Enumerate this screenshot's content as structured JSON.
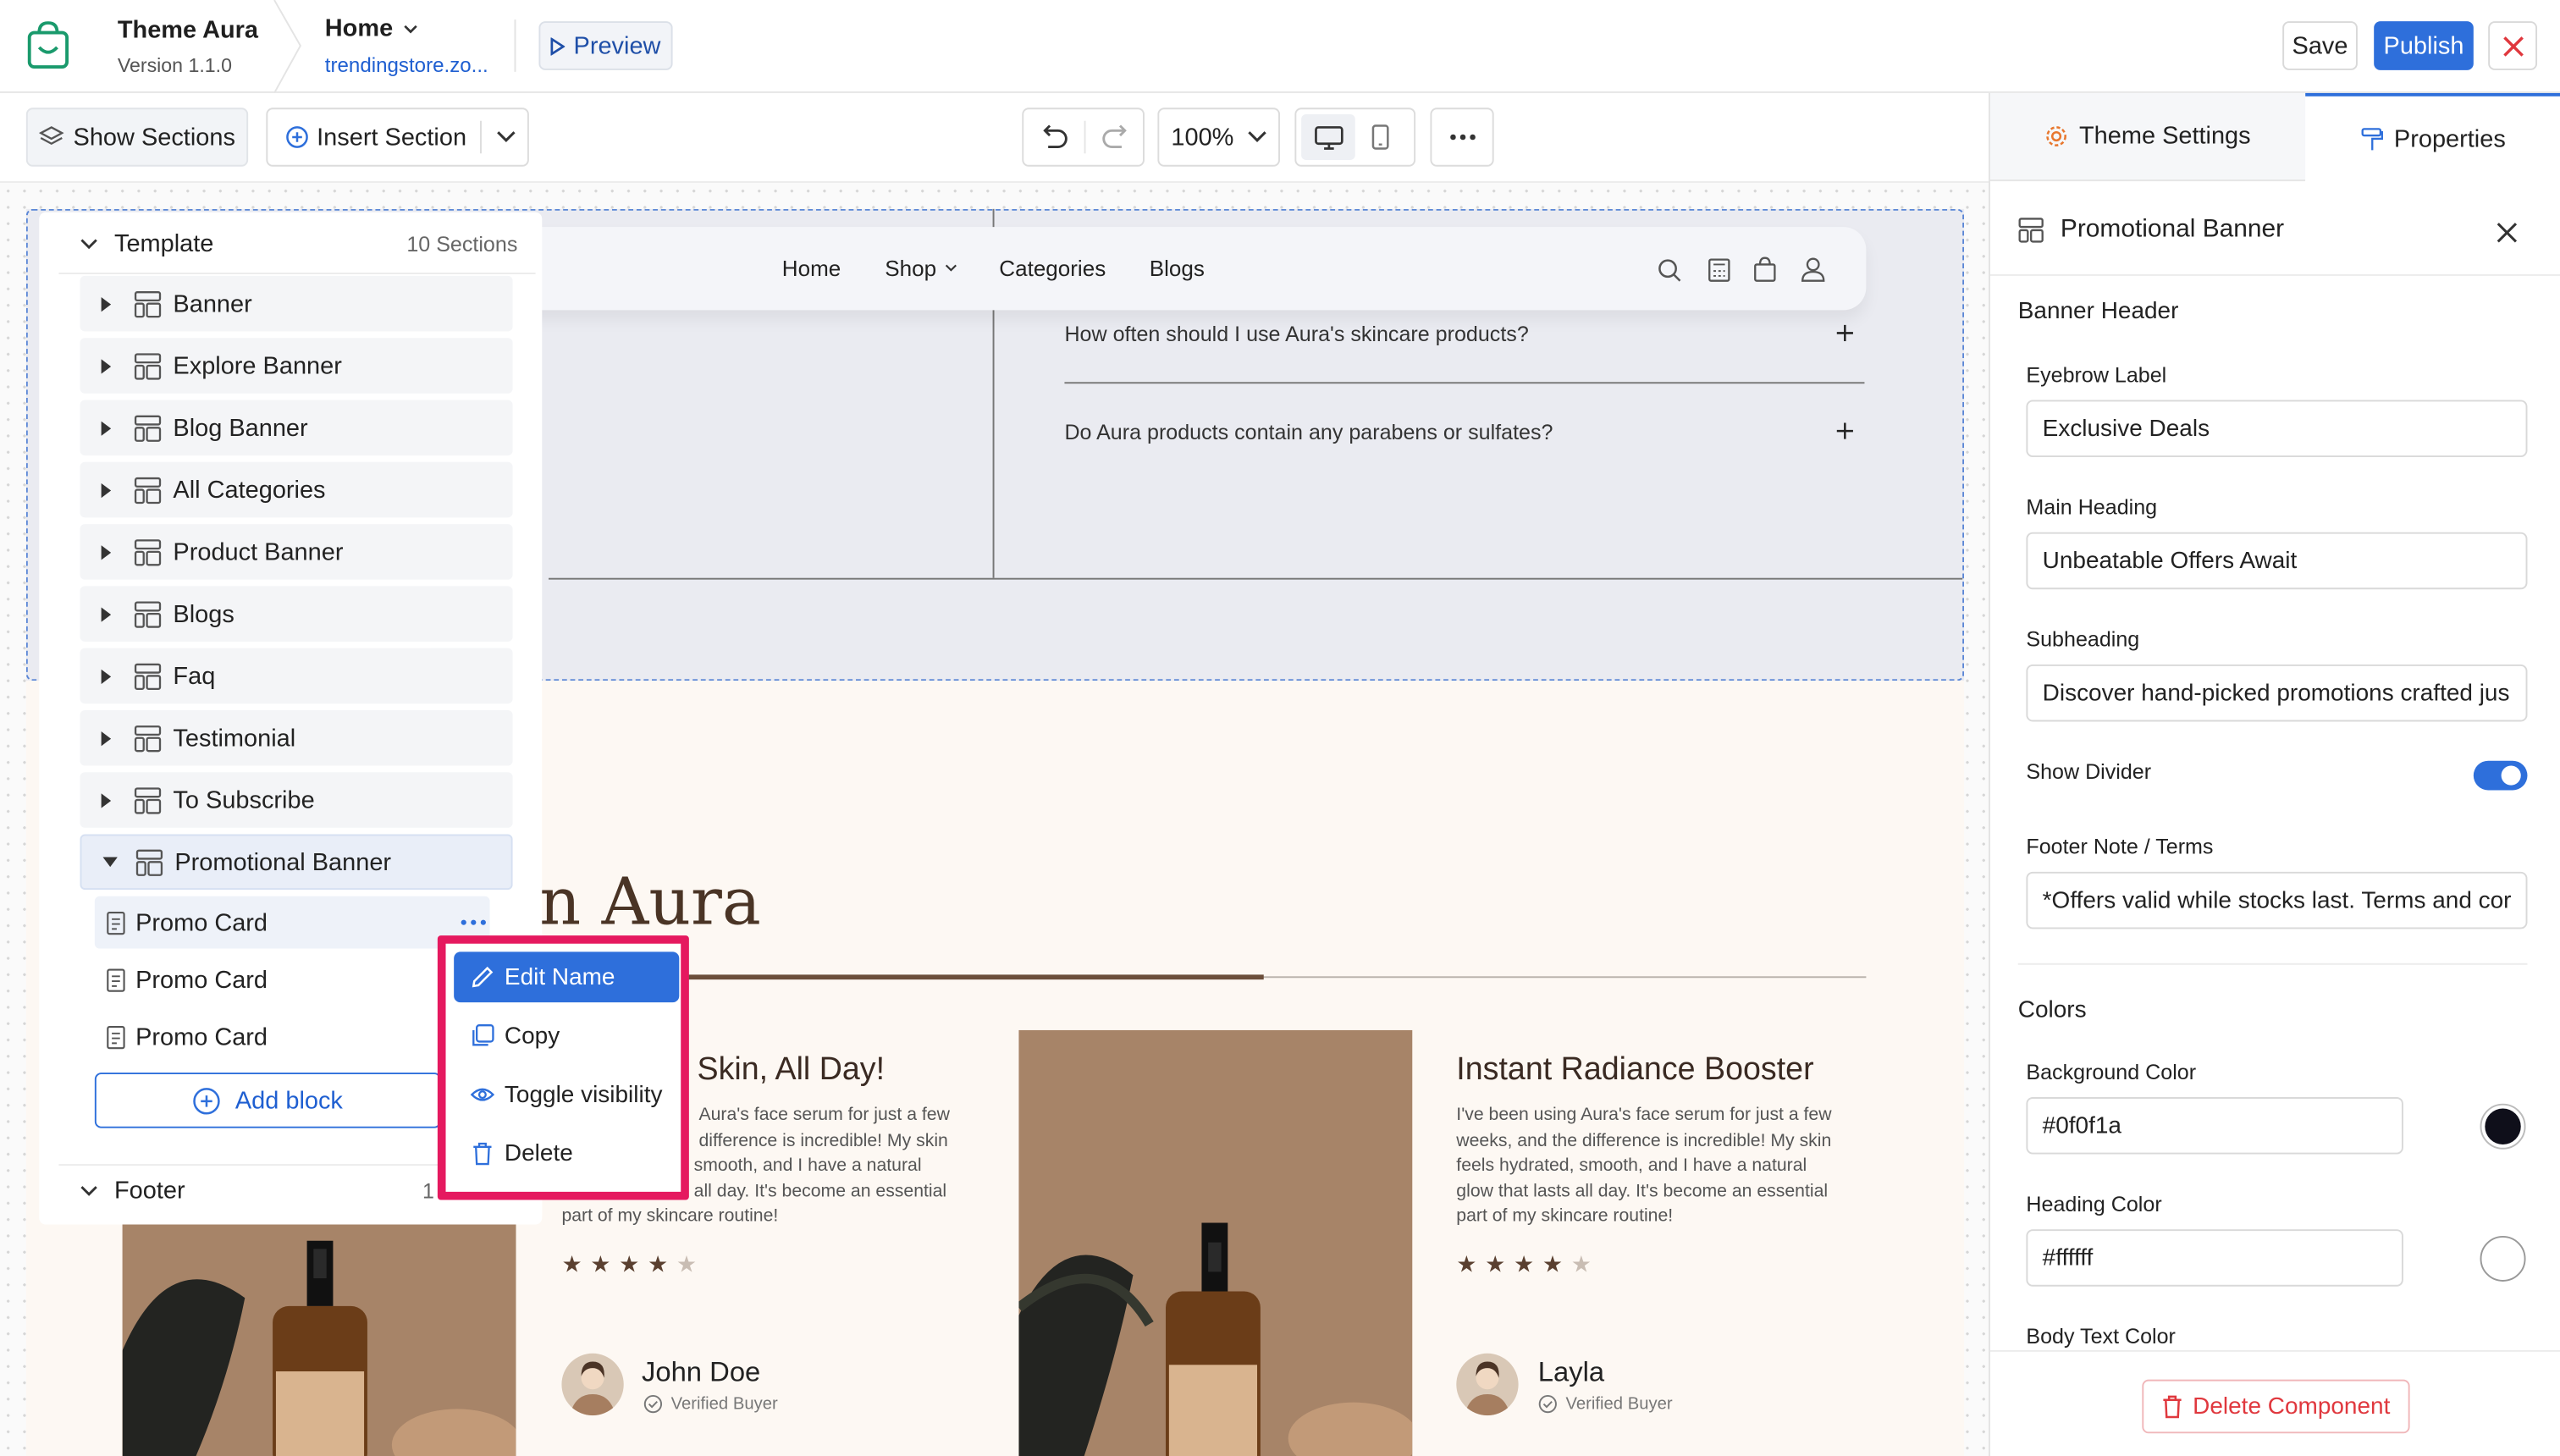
{
  "app": {
    "theme_name": "Theme Aura",
    "version": "Version 1.1.0",
    "page_name": "Home",
    "store_url": "trendingstore.zo...",
    "preview_label": "Preview",
    "save_label": "Save",
    "publish_label": "Publish",
    "accent_color": "#2e6fdb",
    "danger_color": "#e0383e"
  },
  "toolbar": {
    "show_sections_label": "Show Sections",
    "insert_section_label": "Insert Section",
    "zoom": "100%"
  },
  "sections_panel": {
    "template_label": "Template",
    "template_count": "10 Sections",
    "sections": [
      "Banner",
      "Explore Banner",
      "Blog Banner",
      "All Categories",
      "Product Banner",
      "Blogs",
      "Faq",
      "Testimonial",
      "To Subscribe",
      "Promotional Banner"
    ],
    "blocks": [
      "Promo Card",
      "Promo Card",
      "Promo Card"
    ],
    "add_block_label": "Add block",
    "footer_label": "Footer",
    "footer_count": "1"
  },
  "context_menu": {
    "items": [
      "Edit Name",
      "Copy",
      "Toggle visibility",
      "Delete"
    ]
  },
  "preview": {
    "nav": [
      "Home",
      "Shop",
      "Categories",
      "Blogs"
    ],
    "faq": [
      "How often should I use Aura's skincare products?",
      "Do Aura products contain any parabens or sulfates?"
    ],
    "testimonial_heading_partial": "n Aura",
    "cards": [
      {
        "title": "Skin, All Day!",
        "lines": [
          "Aura's face serum for just a few",
          "difference is incredible! My skin",
          "smooth, and I have a natural",
          "all day. It's become an essential",
          "part of my skincare routine!"
        ],
        "rating": 4,
        "name": "John Doe",
        "badge": "Verified Buyer"
      },
      {
        "title": "Instant Radiance Booster",
        "lines": [
          "I've been using Aura's face serum for just a few",
          "weeks, and the difference is incredible! My skin",
          "feels hydrated, smooth, and I have a natural",
          "glow that lasts all day. It's become an essential",
          "part of my skincare routine!"
        ],
        "rating": 4,
        "name": "Layla",
        "badge": "Verified Buyer"
      }
    ]
  },
  "properties": {
    "tab_theme_settings": "Theme Settings",
    "tab_properties": "Properties",
    "component_title": "Promotional Banner",
    "group_banner_header": "Banner Header",
    "eyebrow_label": "Eyebrow Label",
    "eyebrow_value": "Exclusive Deals",
    "main_heading_label": "Main Heading",
    "main_heading_value": "Unbeatable Offers Await",
    "subheading_label": "Subheading",
    "subheading_value": "Discover hand-picked promotions crafted jus",
    "show_divider_label": "Show Divider",
    "show_divider_on": true,
    "footer_note_label": "Footer Note / Terms",
    "footer_note_value": "*Offers valid while stocks last. Terms and cor",
    "group_colors": "Colors",
    "background_color_label": "Background Color",
    "background_color_value": "#0f0f1a",
    "heading_color_label": "Heading Color",
    "heading_color_value": "#ffffff",
    "body_text_color_label": "Body Text Color",
    "delete_label": "Delete Component"
  }
}
